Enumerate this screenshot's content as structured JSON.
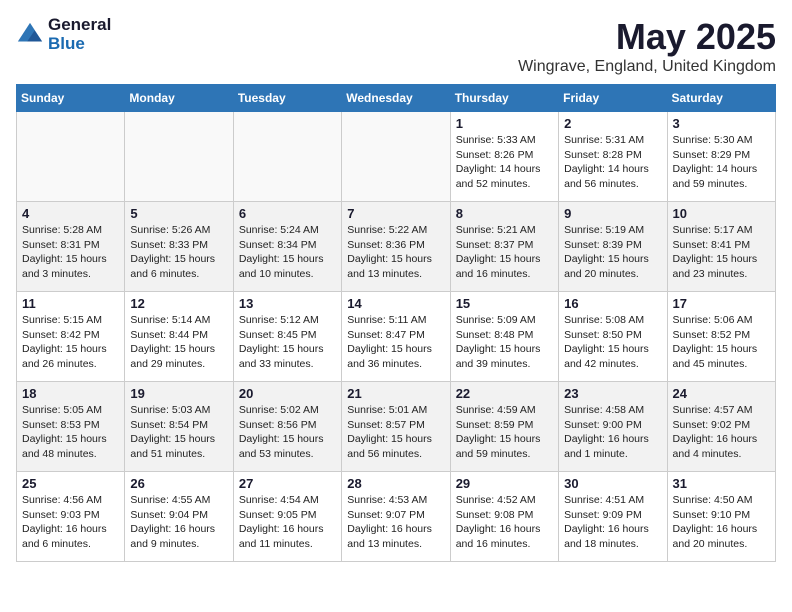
{
  "logo": {
    "general": "General",
    "blue": "Blue"
  },
  "title": "May 2025",
  "subtitle": "Wingrave, England, United Kingdom",
  "days_of_week": [
    "Sunday",
    "Monday",
    "Tuesday",
    "Wednesday",
    "Thursday",
    "Friday",
    "Saturday"
  ],
  "weeks": [
    [
      {
        "day": "",
        "info": ""
      },
      {
        "day": "",
        "info": ""
      },
      {
        "day": "",
        "info": ""
      },
      {
        "day": "",
        "info": ""
      },
      {
        "day": "1",
        "info": "Sunrise: 5:33 AM\nSunset: 8:26 PM\nDaylight: 14 hours\nand 52 minutes."
      },
      {
        "day": "2",
        "info": "Sunrise: 5:31 AM\nSunset: 8:28 PM\nDaylight: 14 hours\nand 56 minutes."
      },
      {
        "day": "3",
        "info": "Sunrise: 5:30 AM\nSunset: 8:29 PM\nDaylight: 14 hours\nand 59 minutes."
      }
    ],
    [
      {
        "day": "4",
        "info": "Sunrise: 5:28 AM\nSunset: 8:31 PM\nDaylight: 15 hours\nand 3 minutes."
      },
      {
        "day": "5",
        "info": "Sunrise: 5:26 AM\nSunset: 8:33 PM\nDaylight: 15 hours\nand 6 minutes."
      },
      {
        "day": "6",
        "info": "Sunrise: 5:24 AM\nSunset: 8:34 PM\nDaylight: 15 hours\nand 10 minutes."
      },
      {
        "day": "7",
        "info": "Sunrise: 5:22 AM\nSunset: 8:36 PM\nDaylight: 15 hours\nand 13 minutes."
      },
      {
        "day": "8",
        "info": "Sunrise: 5:21 AM\nSunset: 8:37 PM\nDaylight: 15 hours\nand 16 minutes."
      },
      {
        "day": "9",
        "info": "Sunrise: 5:19 AM\nSunset: 8:39 PM\nDaylight: 15 hours\nand 20 minutes."
      },
      {
        "day": "10",
        "info": "Sunrise: 5:17 AM\nSunset: 8:41 PM\nDaylight: 15 hours\nand 23 minutes."
      }
    ],
    [
      {
        "day": "11",
        "info": "Sunrise: 5:15 AM\nSunset: 8:42 PM\nDaylight: 15 hours\nand 26 minutes."
      },
      {
        "day": "12",
        "info": "Sunrise: 5:14 AM\nSunset: 8:44 PM\nDaylight: 15 hours\nand 29 minutes."
      },
      {
        "day": "13",
        "info": "Sunrise: 5:12 AM\nSunset: 8:45 PM\nDaylight: 15 hours\nand 33 minutes."
      },
      {
        "day": "14",
        "info": "Sunrise: 5:11 AM\nSunset: 8:47 PM\nDaylight: 15 hours\nand 36 minutes."
      },
      {
        "day": "15",
        "info": "Sunrise: 5:09 AM\nSunset: 8:48 PM\nDaylight: 15 hours\nand 39 minutes."
      },
      {
        "day": "16",
        "info": "Sunrise: 5:08 AM\nSunset: 8:50 PM\nDaylight: 15 hours\nand 42 minutes."
      },
      {
        "day": "17",
        "info": "Sunrise: 5:06 AM\nSunset: 8:52 PM\nDaylight: 15 hours\nand 45 minutes."
      }
    ],
    [
      {
        "day": "18",
        "info": "Sunrise: 5:05 AM\nSunset: 8:53 PM\nDaylight: 15 hours\nand 48 minutes."
      },
      {
        "day": "19",
        "info": "Sunrise: 5:03 AM\nSunset: 8:54 PM\nDaylight: 15 hours\nand 51 minutes."
      },
      {
        "day": "20",
        "info": "Sunrise: 5:02 AM\nSunset: 8:56 PM\nDaylight: 15 hours\nand 53 minutes."
      },
      {
        "day": "21",
        "info": "Sunrise: 5:01 AM\nSunset: 8:57 PM\nDaylight: 15 hours\nand 56 minutes."
      },
      {
        "day": "22",
        "info": "Sunrise: 4:59 AM\nSunset: 8:59 PM\nDaylight: 15 hours\nand 59 minutes."
      },
      {
        "day": "23",
        "info": "Sunrise: 4:58 AM\nSunset: 9:00 PM\nDaylight: 16 hours\nand 1 minute."
      },
      {
        "day": "24",
        "info": "Sunrise: 4:57 AM\nSunset: 9:02 PM\nDaylight: 16 hours\nand 4 minutes."
      }
    ],
    [
      {
        "day": "25",
        "info": "Sunrise: 4:56 AM\nSunset: 9:03 PM\nDaylight: 16 hours\nand 6 minutes."
      },
      {
        "day": "26",
        "info": "Sunrise: 4:55 AM\nSunset: 9:04 PM\nDaylight: 16 hours\nand 9 minutes."
      },
      {
        "day": "27",
        "info": "Sunrise: 4:54 AM\nSunset: 9:05 PM\nDaylight: 16 hours\nand 11 minutes."
      },
      {
        "day": "28",
        "info": "Sunrise: 4:53 AM\nSunset: 9:07 PM\nDaylight: 16 hours\nand 13 minutes."
      },
      {
        "day": "29",
        "info": "Sunrise: 4:52 AM\nSunset: 9:08 PM\nDaylight: 16 hours\nand 16 minutes."
      },
      {
        "day": "30",
        "info": "Sunrise: 4:51 AM\nSunset: 9:09 PM\nDaylight: 16 hours\nand 18 minutes."
      },
      {
        "day": "31",
        "info": "Sunrise: 4:50 AM\nSunset: 9:10 PM\nDaylight: 16 hours\nand 20 minutes."
      }
    ]
  ],
  "colors": {
    "header_bg": "#2e75b6",
    "header_text": "#ffffff",
    "title_color": "#1a1a2e",
    "logo_blue": "#1a6ab1"
  }
}
